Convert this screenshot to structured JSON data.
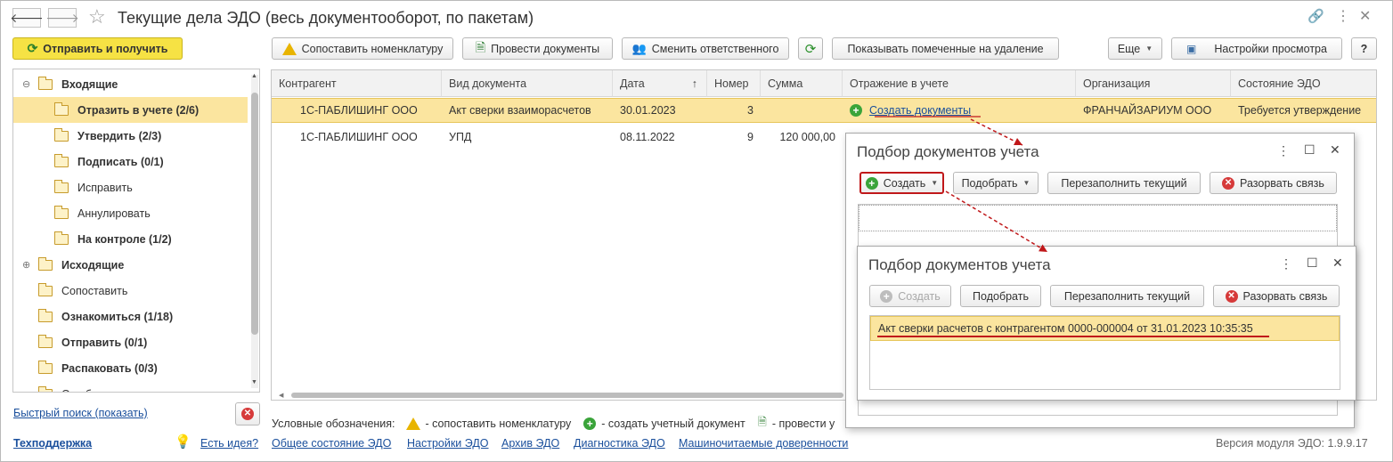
{
  "window": {
    "title": "Текущие дела ЭДО (весь документооборот, по пакетам)"
  },
  "toolbar": {
    "send_receive": "Отправить и получить",
    "match_nomenclature": "Сопоставить номенклатуру",
    "post_documents": "Провести документы",
    "change_responsible": "Сменить ответственного",
    "show_deleted": "Показывать помеченные на удаление",
    "more": "Еще",
    "view_settings": "Настройки просмотра",
    "help": "?"
  },
  "sidebar": {
    "items": [
      {
        "label": "Входящие",
        "bold": true,
        "level": 0,
        "expander": "⊖",
        "selected": false
      },
      {
        "label": "Отразить в учете (2/6)",
        "bold": true,
        "level": 1,
        "selected": true
      },
      {
        "label": "Утвердить (2/3)",
        "bold": true,
        "level": 1,
        "selected": false
      },
      {
        "label": "Подписать (0/1)",
        "bold": true,
        "level": 1,
        "selected": false
      },
      {
        "label": "Исправить",
        "bold": false,
        "level": 1,
        "selected": false
      },
      {
        "label": "Аннулировать",
        "bold": false,
        "level": 1,
        "selected": false
      },
      {
        "label": "На контроле (1/2)",
        "bold": true,
        "level": 1,
        "selected": false
      },
      {
        "label": "Исходящие",
        "bold": true,
        "level": 0,
        "expander": "⊕",
        "selected": false
      },
      {
        "label": "Сопоставить",
        "bold": false,
        "level": 0,
        "selected": false
      },
      {
        "label": "Ознакомиться (1/18)",
        "bold": true,
        "level": 0,
        "selected": false
      },
      {
        "label": "Отправить (0/1)",
        "bold": true,
        "level": 0,
        "selected": false
      },
      {
        "label": "Распаковать (0/3)",
        "bold": true,
        "level": 0,
        "selected": false
      },
      {
        "label": "Ошибки",
        "bold": false,
        "level": 0,
        "selected": false
      }
    ],
    "quick_search": "Быстрый поиск (показать)"
  },
  "table": {
    "columns": [
      "Контрагент",
      "Вид документа",
      "Дата",
      "Номер",
      "Сумма",
      "Отражение в учете",
      "Организация",
      "Состояние ЭДО"
    ],
    "sort_indicator": "↑",
    "rows": [
      {
        "counterparty": "1С-ПАБЛИШИНГ ООО",
        "doc_type": "Акт сверки взаиморасчетов",
        "date": "30.01.2023",
        "number": "3",
        "sum": "",
        "accounting": "Создать документы",
        "organization": "ФРАНЧАЙЗАРИУМ ООО",
        "state": "Требуется утверждение"
      },
      {
        "counterparty": "1С-ПАБЛИШИНГ ООО",
        "doc_type": "УПД",
        "date": "08.11.2022",
        "number": "9",
        "sum": "120 000,00",
        "accounting": "",
        "organization": "",
        "state": ""
      }
    ]
  },
  "legend": {
    "label": "Условные обозначения:",
    "match": "- сопоставить номенклатуру",
    "create": "- создать учетный документ",
    "post": "- провести у"
  },
  "popup1": {
    "title": "Подбор документов учета",
    "create": "Создать",
    "select": "Подобрать",
    "refill": "Перезаполнить текущий",
    "unlink": "Разорвать связь"
  },
  "popup2": {
    "title": "Подбор документов учета",
    "create": "Создать",
    "select": "Подобрать",
    "refill": "Перезаполнить текущий",
    "unlink": "Разорвать связь",
    "row": "Акт сверки расчетов с контрагентом 0000-000004 от 31.01.2023 10:35:35"
  },
  "footer": {
    "support": "Техподдержка",
    "idea": "Есть идея?",
    "edo_state": "Общее состояние ЭДО",
    "edo_settings": "Настройки ЭДО",
    "edo_archive": "Архив ЭДО",
    "edo_diagnostics": "Диагностика ЭДО",
    "poa": "Машиночитаемые доверенности",
    "version": "Версия модуля ЭДО: 1.9.9.17"
  },
  "colors": {
    "accent_yellow": "#f6e244",
    "selection": "#fbe59f",
    "link": "#1a4f9c",
    "annotation_red": "#c0181a"
  }
}
